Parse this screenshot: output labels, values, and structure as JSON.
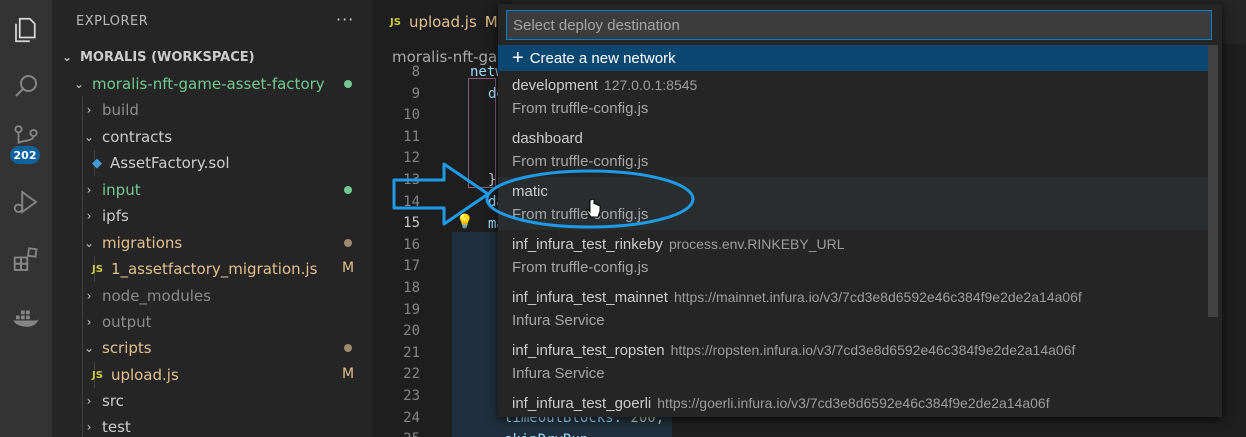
{
  "activity_bar": {
    "icons": [
      "explorer-icon",
      "search-icon",
      "source-control-icon",
      "run-debug-icon",
      "extensions-icon",
      "docker-icon"
    ],
    "scm_badge": "202"
  },
  "sidebar": {
    "header": "EXPLORER",
    "more": "···",
    "workspace": "MORALIS (WORKSPACE)",
    "items": [
      {
        "label": "moralis-nft-game-asset-factory",
        "kind": "folder-open",
        "color": "#73c991"
      },
      {
        "label": "build",
        "kind": "folder",
        "color": "#8c8c8c"
      },
      {
        "label": "contracts",
        "kind": "folder-open",
        "color": "#cccccc"
      },
      {
        "label": "AssetFactory.sol",
        "kind": "file-sol",
        "color": "#cccccc"
      },
      {
        "label": "input",
        "kind": "folder",
        "color": "#73c991"
      },
      {
        "label": "ipfs",
        "kind": "folder",
        "color": "#cccccc"
      },
      {
        "label": "migrations",
        "kind": "folder-open",
        "color": "#e2c08d"
      },
      {
        "label": "1_assetfactory_migration.js",
        "kind": "file-js",
        "color": "#e2c08d",
        "mark": "M"
      },
      {
        "label": "node_modules",
        "kind": "folder",
        "color": "#8c8c8c"
      },
      {
        "label": "output",
        "kind": "folder",
        "color": "#8c8c8c"
      },
      {
        "label": "scripts",
        "kind": "folder-open",
        "color": "#e2c08d"
      },
      {
        "label": "upload.js",
        "kind": "file-js",
        "color": "#e2c08d",
        "mark": "M"
      },
      {
        "label": "src",
        "kind": "folder",
        "color": "#cccccc"
      },
      {
        "label": "test",
        "kind": "folder",
        "color": "#cccccc"
      }
    ]
  },
  "editor": {
    "tab": {
      "icon": "JS",
      "label": "upload.js",
      "modified": "M"
    },
    "breadcrumb": "moralis-nft-gam",
    "line_numbers": [
      "8",
      "9",
      "10",
      "11",
      "12",
      "13",
      "14",
      "15",
      "16",
      "17",
      "18",
      "19",
      "20",
      "21",
      "22",
      "23",
      "24",
      "25"
    ],
    "active_line": "15",
    "code_fragments": {
      "l8": "netw",
      "l9": "de",
      "l13": "},",
      "l14": "da",
      "l15": "ma",
      "l24_key": "timeoutBlocks: ",
      "l24_val": "200,",
      "l25": "skipDryRun"
    }
  },
  "quick_pick": {
    "placeholder": "Select deploy destination",
    "create_label": "Create a new network",
    "items": [
      {
        "title": "development",
        "desc": "127.0.0.1:8545",
        "detail": "From truffle-config.js"
      },
      {
        "title": "dashboard",
        "desc": "",
        "detail": "From truffle-config.js"
      },
      {
        "title": "matic",
        "desc": "",
        "detail": "From truffle-config.js"
      },
      {
        "title": "inf_infura_test_rinkeby",
        "desc": "process.env.RINKEBY_URL",
        "detail": "From truffle-config.js"
      },
      {
        "title": "inf_infura_test_mainnet",
        "desc": "https://mainnet.infura.io/v3/7cd3e8d6592e46c384f9e2de2a14a06f",
        "detail": "Infura Service"
      },
      {
        "title": "inf_infura_test_ropsten",
        "desc": "https://ropsten.infura.io/v3/7cd3e8d6592e46c384f9e2de2a14a06f",
        "detail": "Infura Service"
      },
      {
        "title": "inf_infura_test_goerli",
        "desc": "https://goerli.infura.io/v3/7cd3e8d6592e46c384f9e2de2a14a06f",
        "detail": ""
      }
    ]
  },
  "colors": {
    "accent": "#007fd4",
    "selection": "#094771",
    "annotation": "#1e9be8"
  }
}
